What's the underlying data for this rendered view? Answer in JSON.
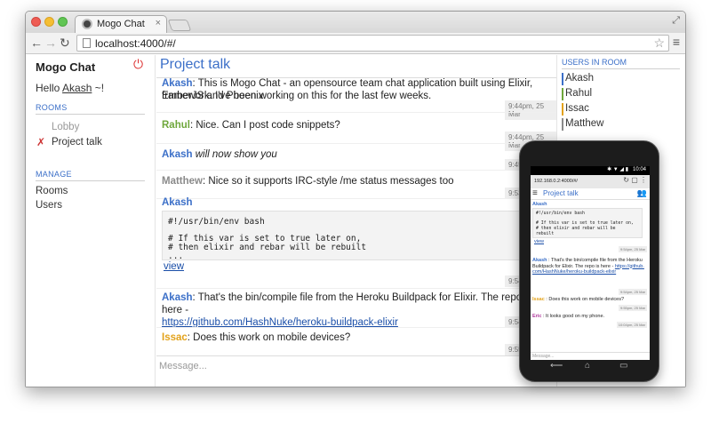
{
  "browser": {
    "tab_title": "Mogo Chat",
    "tab_close": "×",
    "back": "←",
    "forward": "→",
    "reload": "↻",
    "url": "localhost:4000/#/",
    "star": "☆",
    "menu": "≡",
    "fullscreen": "⤢"
  },
  "sidebar": {
    "app_title": "Mogo Chat",
    "power": "⏻",
    "hello_prefix": "Hello ",
    "hello_user": "Akash",
    "hello_suffix": " ~!",
    "rooms_label": "ROOMS",
    "rooms": [
      {
        "label": "Lobby",
        "active": false
      },
      {
        "label": "Project talk",
        "active": true
      }
    ],
    "active_marker": "✗",
    "manage_label": "MANAGE",
    "manage": [
      "Rooms",
      "Users"
    ]
  },
  "main": {
    "room_title": "Project talk",
    "messages": [
      {
        "name": "Akash",
        "text": ": This is Mogo Chat - an opensource team chat application built using Elixir, EmberJS and Phoenix",
        "text2": "framework. I've been working on this for the last few weeks.",
        "time": "9:44pm, 25 Mar"
      },
      {
        "name": "Rahul",
        "text": ": Nice. Can I post code snippets?",
        "time": "9:44pm, 25 Mar"
      },
      {
        "name": "Akash",
        "text": "will now show you",
        "time": "9:45"
      },
      {
        "name": "Matthew",
        "text": ": Nice so it supports IRC-style /me status messages too",
        "time": "9:53"
      },
      {
        "name": "Akash",
        "time": "9:54"
      },
      {
        "name": "Akash",
        "text": ": That's the bin/compile file from the Heroku Buildpack for Elixir. The repo is here -",
        "link": "https://github.com/HashNuke/heroku-buildpack-elixir",
        "time": "9:54"
      },
      {
        "name": "Issac",
        "text": ": Does this work on mobile devices?",
        "time": "9:55"
      }
    ],
    "code_lines": [
      "#!/usr/bin/env bash",
      "",
      "# If this var is set to true later on,",
      "# then elixir and rebar will be rebuilt",
      "..."
    ],
    "view_link": "view",
    "input_placeholder": "Message..."
  },
  "users": {
    "label": "USERS IN ROOM",
    "list": [
      {
        "name": "Akash",
        "color": "#3b6fc8"
      },
      {
        "name": "Rahul",
        "color": "#6fa73c"
      },
      {
        "name": "Issac",
        "color": "#e3a21a"
      },
      {
        "name": "Matthew",
        "color": "#8a8a8a"
      }
    ]
  },
  "phone": {
    "time": "10:04",
    "status_icons": "✱ ▼ ◢ ▮",
    "url": "192.168.0.2:4000/#/",
    "url_icons": "↻ ▢ ⋮",
    "hamburger": "≡",
    "title": "Project talk",
    "users_icon": "👥",
    "name1": "Akash",
    "code_lines": [
      "#!/usr/bin/env bash",
      "",
      "# If this var is set to true later on,",
      "# then elixir and rebar will be",
      "rebuilt",
      "..."
    ],
    "view": "view",
    "ts1": "9:54pm, 25 Mar",
    "msg2_name": "Akash",
    "msg2_text": " : That's the bin/compile file from the Heroku Buildpack for Elixir. The repo is here -",
    "msg2_link": "https://github.com/HashNuke/heroku-buildpack-elixir",
    "ts2": "9:54pm, 25 Mar",
    "msg3_name": "Issac",
    "msg3_text": " : Does this work on mobile devices?",
    "ts3": "9:55pm, 25 Mar",
    "msg4_name": "Eric",
    "msg4_text": " : It looks good on my phone.",
    "ts4": "10:04pm, 25 Mar",
    "input_placeholder": "Message...",
    "nav_back": "⟵",
    "nav_home": "⌂",
    "nav_recent": "▭"
  }
}
